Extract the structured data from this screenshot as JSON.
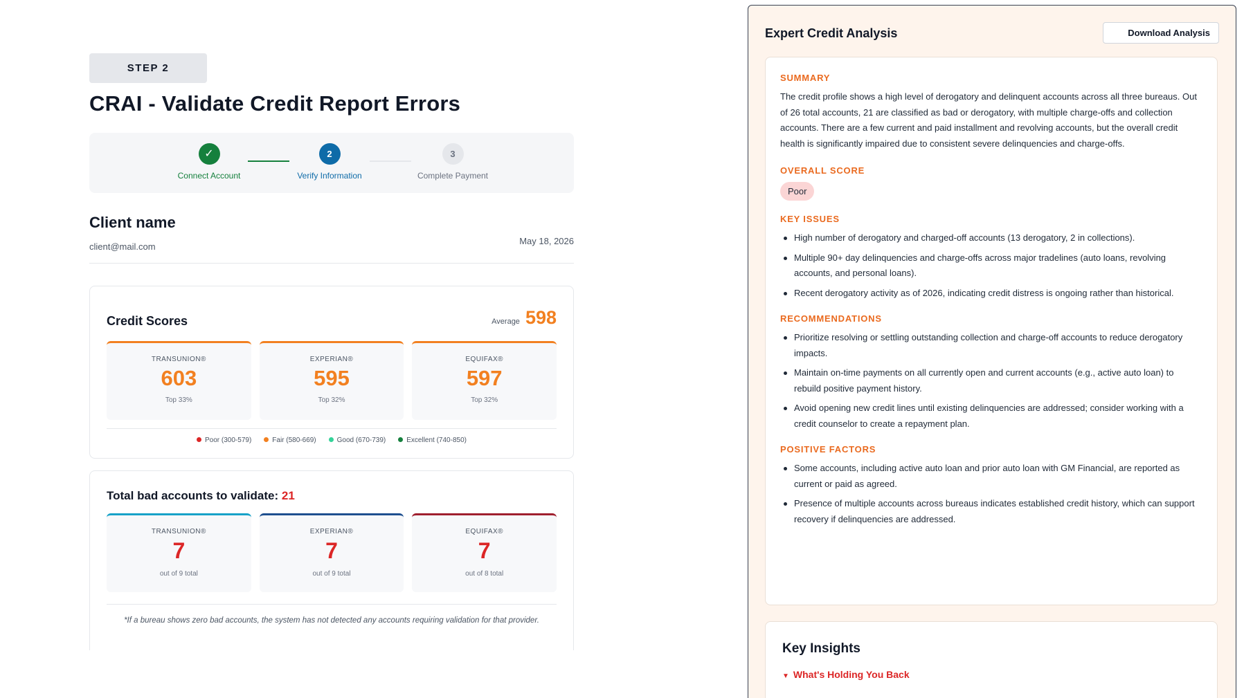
{
  "header": {
    "step_badge": "STEP 2",
    "title": "CRAI - Validate Credit Report Errors"
  },
  "stepper": {
    "steps": [
      {
        "number": "✓",
        "label": "Connect Account",
        "state": "done"
      },
      {
        "number": "2",
        "label": "Verify Information",
        "state": "active"
      },
      {
        "number": "3",
        "label": "Complete Payment",
        "state": "todo"
      }
    ]
  },
  "client": {
    "name": "Client name",
    "email": "client@mail.com",
    "date": "May 18, 2026"
  },
  "credit_scores": {
    "title": "Credit Scores",
    "average_label": "Average",
    "average_value": "598",
    "bureaus": [
      {
        "name": "TRANSUNION®",
        "score": "603",
        "top": "Top 33%"
      },
      {
        "name": "EXPERIAN®",
        "score": "595",
        "top": "Top 32%"
      },
      {
        "name": "EQUIFAX®",
        "score": "597",
        "top": "Top 32%"
      }
    ],
    "legend": [
      {
        "label": "Poor (300-579)",
        "color": "#dc2626"
      },
      {
        "label": "Fair (580-669)",
        "color": "#f28020"
      },
      {
        "label": "Good (670-739)",
        "color": "#34d399"
      },
      {
        "label": "Excellent (740-850)",
        "color": "#15803d"
      }
    ]
  },
  "bad_accounts": {
    "title": "Total bad accounts to validate:",
    "count": "21",
    "bureaus": [
      {
        "name": "TRANSUNION®",
        "value": "7",
        "out_of": "out of 9 total",
        "color": "#17a2c8"
      },
      {
        "name": "EXPERIAN®",
        "value": "7",
        "out_of": "out of 9 total",
        "color": "#1e4f8f"
      },
      {
        "name": "EQUIFAX®",
        "value": "7",
        "out_of": "out of 8 total",
        "color": "#9f1f2e"
      }
    ],
    "note": "*If a bureau shows zero bad accounts, the system has not detected any accounts requiring validation for that provider."
  },
  "panel": {
    "title": "Expert Credit Analysis",
    "download_label": "Download Analysis",
    "summary_title": "SUMMARY",
    "summary_text": "The credit profile shows a high level of derogatory and delinquent accounts across all three bureaus. Out of 26 total accounts, 21 are classified as bad or derogatory, with multiple charge-offs and collection accounts. There are a few current and paid installment and revolving accounts, but the overall credit health is significantly impaired due to consistent severe delinquencies and charge-offs.",
    "overall_title": "OVERALL SCORE",
    "overall_value": "Poor",
    "key_issues_title": "KEY ISSUES",
    "key_issues": [
      "High number of derogatory and charged-off accounts (13 derogatory, 2 in collections).",
      "Multiple 90+ day delinquencies and charge-offs across major tradelines (auto loans, revolving accounts, and personal loans).",
      "Recent derogatory activity as of 2026, indicating credit distress is ongoing rather than historical."
    ],
    "recommendations_title": "RECOMMENDATIONS",
    "recommendations": [
      "Prioritize resolving or settling outstanding collection and charge-off accounts to reduce derogatory impacts.",
      "Maintain on-time payments on all currently open and current accounts (e.g., active auto loan) to rebuild positive payment history.",
      "Avoid opening new credit lines until existing delinquencies are addressed; consider working with a credit counselor to create a repayment plan."
    ],
    "positive_title": "POSITIVE FACTORS",
    "positive": [
      "Some accounts, including active auto loan and prior auto loan with GM Financial, are reported as current or paid as agreed.",
      "Presence of multiple accounts across bureaus indicates established credit history, which can support recovery if delinquencies are addressed."
    ],
    "insights_title": "Key Insights",
    "holding_back": "What's Holding You Back"
  }
}
